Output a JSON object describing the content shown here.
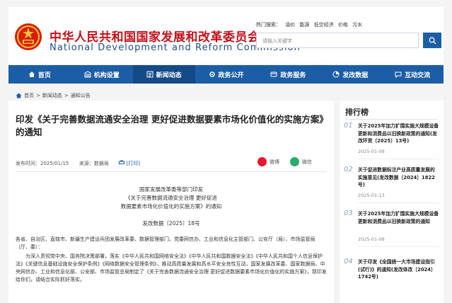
{
  "header": {
    "title_cn": "中华人民共和国国家发展和改革委员会",
    "title_en": "National Development and Reform Commission",
    "hot_label": "热门搜索：",
    "hot_terms": [
      "油价",
      "能源",
      "低空经济",
      "价格",
      "污水"
    ],
    "search_placeholder": "请输入关键字"
  },
  "nav": {
    "items": [
      {
        "label": "首页",
        "icon": "home-icon"
      },
      {
        "label": "机构设置",
        "icon": "building-icon"
      },
      {
        "label": "新闻动态",
        "icon": "news-icon"
      },
      {
        "label": "政务公开",
        "icon": "gear-icon"
      },
      {
        "label": "政务服务",
        "icon": "service-icon"
      },
      {
        "label": "发改数据",
        "icon": "data-icon"
      },
      {
        "label": "互动交流",
        "icon": "chat-icon"
      }
    ]
  },
  "breadcrumb": {
    "home": "首页",
    "sep": ">",
    "level1": "新闻动态",
    "level2": "通知公告"
  },
  "article": {
    "title": "印发《关于完善数据流通安全治理 更好促进数据要素市场化价值化的实施方案》的通知",
    "publish_time": "发布时间：2025/01/15",
    "source": "来源：数据局",
    "print": "[打印]",
    "share_weibo": "微博",
    "share_wechat": "微信",
    "issuer": "国家发展改革委等部门印发",
    "doc_title_1": "《关于完善数据流通安全治理 更好促进",
    "doc_title_2": "数据要素市场化价值化的实施方案》的通知",
    "doc_number": "发改数据〔2025〕18号",
    "recipients": "各省、自治区、直辖市、新疆生产建设兵团发展改革委、数据管理部门、党委网信办、工业和信息化主管部门、公安厅（局）、市场监管局（厅、委）：",
    "body": "为深入贯彻党中央、国务院决策部署，落实《中华人民共和国网络安全法》《中华人民共和国数据安全法》《中华人民共和国个人信息保护法》《关键信息基础设施安全保护条例》《网络数据安全管理条例》，推动高质量发展和高水平安全良性互动，国家发展改革委、国家数据局、中央网信办、工业和信息化部、公安部、市场监管总局制定了《关于完善数据流通安全治理 更好促进数据要素市场化价值化的实施方案》，现印发给你们，请结合实际抓好落实。"
  },
  "sidebar": {
    "title": "排行榜",
    "items": [
      {
        "num": "01",
        "text": "关于2025年加力扩围实施大规模设备更新和消费品以旧换新政策的通知(发改环资〔2025〕13号)",
        "date": "2025-01-08"
      },
      {
        "num": "02",
        "text": "关于促进数据标注产业高质量发展的实施意见(发改数据〔2024〕1822号)",
        "date": "2025-01-13"
      },
      {
        "num": "03",
        "text": "关于2025年加力扩围实施大规模设备更新和消费品以旧换新政策的通知",
        "date": "2025-01-08"
      },
      {
        "num": "04",
        "text": "关于印发《全国统一大市场建设指引(试行)》的通知(发改体改〔2024〕1742号)",
        "date": ""
      }
    ]
  },
  "colors": {
    "brand_red": "#c3111a",
    "brand_blue": "#1c5ea6",
    "nav_active": "#134a87"
  }
}
